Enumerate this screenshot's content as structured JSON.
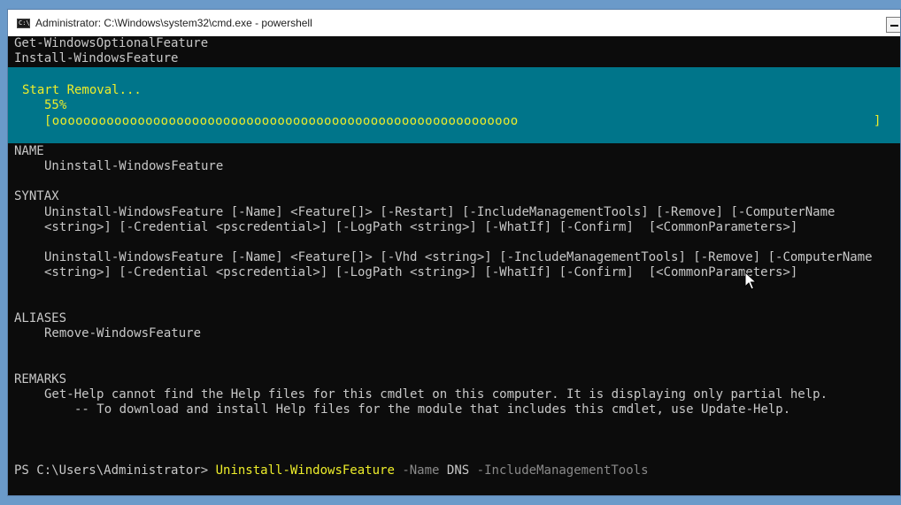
{
  "window": {
    "title": "Administrator: C:\\Windows\\system32\\cmd.exe - powershell",
    "icon": "cmd-icon"
  },
  "console": {
    "history": [
      "Get-WindowsOptionalFeature",
      "Install-WindowsFeature"
    ],
    "progress": {
      "activity": "Start Removal...",
      "percent_text": "55%",
      "percent": 55,
      "bar_open": "[",
      "bar_fill": "oooooooooooooooooooooooooooooooooooooooooooooooooooooooooooo",
      "bar_close": "]"
    },
    "help": {
      "name_header": "NAME",
      "name_value": "Uninstall-WindowsFeature",
      "syntax_header": "SYNTAX",
      "syntax1_line1": "Uninstall-WindowsFeature [-Name] <Feature[]> [-Restart] [-IncludeManagementTools] [-Remove] [-ComputerName",
      "syntax1_line2": "<string>] [-Credential <pscredential>] [-LogPath <string>] [-WhatIf] [-Confirm]  [<CommonParameters>]",
      "syntax2_line1": "Uninstall-WindowsFeature [-Name] <Feature[]> [-Vhd <string>] [-IncludeManagementTools] [-Remove] [-ComputerName",
      "syntax2_line2": "<string>] [-Credential <pscredential>] [-LogPath <string>] [-WhatIf] [-Confirm]  [<CommonParameters>]",
      "aliases_header": "ALIASES",
      "aliases_value": "Remove-WindowsFeature",
      "remarks_header": "REMARKS",
      "remarks_line1": "Get-Help cannot find the Help files for this cmdlet on this computer. It is displaying only partial help.",
      "remarks_line2": "-- To download and install Help files for the module that includes this cmdlet, use Update-Help."
    },
    "prompt": {
      "path": "PS C:\\Users\\Administrator>",
      "command": "Uninstall-WindowsFeature",
      "param1": "-Name",
      "value1": "DNS",
      "param2": "-IncludeManagementTools"
    }
  },
  "colors": {
    "background": "#0c0c0c",
    "progress_band": "#00758a",
    "progress_text": "#eded2a",
    "text": "#c8c8c8",
    "parameter": "#8a8a8a"
  }
}
